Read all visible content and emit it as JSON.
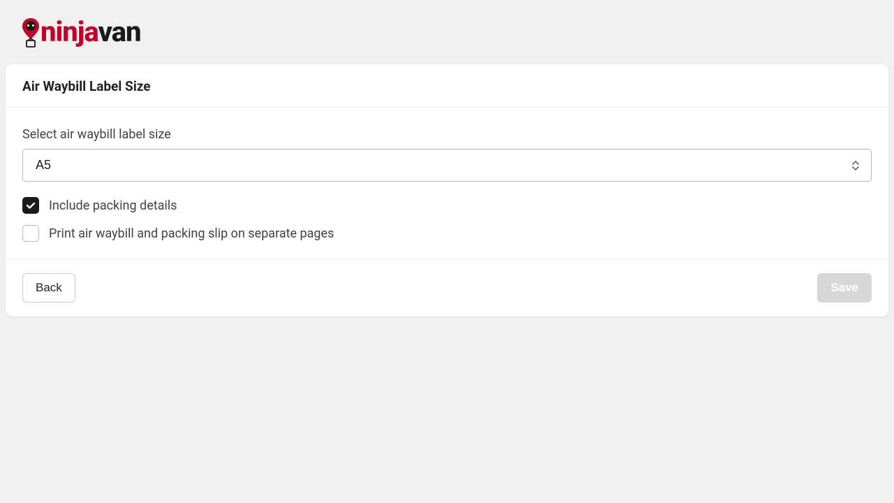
{
  "brand": {
    "name_part1": "ninja",
    "name_part2": "van",
    "accent_color": "#c2002a"
  },
  "card": {
    "title": "Air Waybill Label Size",
    "select_label": "Select air waybill label size",
    "select_value": "A5",
    "checkbox1": {
      "label": "Include packing details",
      "checked": true
    },
    "checkbox2": {
      "label": "Print air waybill and packing slip on separate pages",
      "checked": false
    },
    "back_label": "Back",
    "save_label": "Save"
  }
}
